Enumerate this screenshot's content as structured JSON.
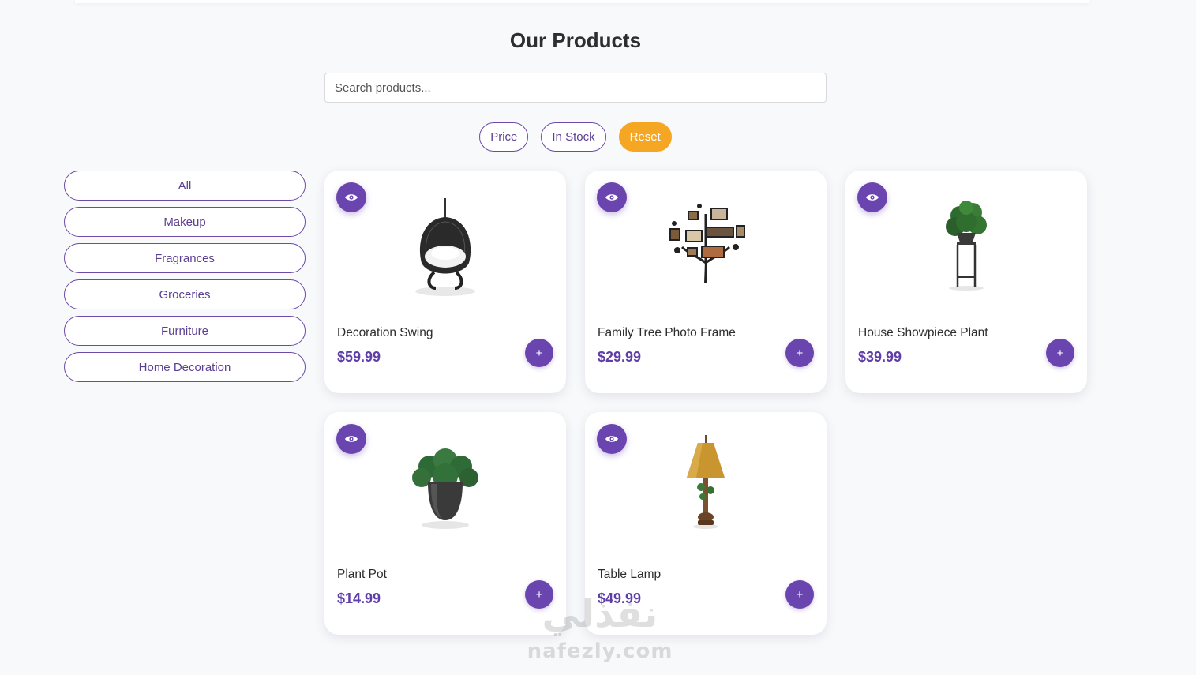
{
  "page": {
    "title": "Our Products"
  },
  "search": {
    "placeholder": "Search products..."
  },
  "filters": {
    "price": "Price",
    "in_stock": "In Stock",
    "reset": "Reset"
  },
  "categories": [
    "All",
    "Makeup",
    "Fragrances",
    "Groceries",
    "Furniture",
    "Home Decoration"
  ],
  "products": [
    {
      "name": "Decoration Swing",
      "price": "$59.99",
      "image": "hanging-swing-chair",
      "add_label": "+"
    },
    {
      "name": "Family Tree Photo Frame",
      "price": "$29.99",
      "image": "family-tree-frame",
      "add_label": "+"
    },
    {
      "name": "House Showpiece Plant",
      "price": "$39.99",
      "image": "plant-on-stand",
      "add_label": "+"
    },
    {
      "name": "Plant Pot",
      "price": "$14.99",
      "image": "potted-plant",
      "add_label": "+"
    },
    {
      "name": "Table Lamp",
      "price": "$49.99",
      "image": "table-lamp",
      "add_label": "+"
    }
  ],
  "icons": {
    "view": "eye-icon",
    "add": "plus-icon"
  },
  "colors": {
    "primary": "#6a45b0",
    "accent": "#f5a623",
    "text": "#2c2c2c",
    "background": "#f8f9fb"
  },
  "watermark": {
    "arabic": "نفذلي",
    "latin": "nafezly.com"
  }
}
